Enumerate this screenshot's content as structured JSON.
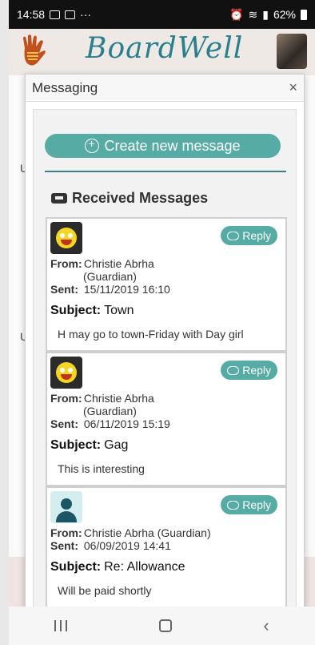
{
  "status_bar": {
    "time": "14:58",
    "battery": "62%",
    "more": "···"
  },
  "app": {
    "brand": "BoardWell"
  },
  "modal": {
    "title": "Messaging",
    "close": "×",
    "create_button": "Create new message",
    "received_heading": "Received Messages",
    "labels": {
      "from": "From:",
      "sent": "Sent:",
      "subject": "Subject:",
      "reply": "Reply"
    },
    "messages": [
      {
        "avatar": "emoji-face",
        "from": "Christie Abrha",
        "from_role": "(Guardian)",
        "sent": "15/11/2019 16:10",
        "subject": "Town",
        "body": "H may go to town-Friday with Day girl"
      },
      {
        "avatar": "emoji-face",
        "from": "Christie Abrha",
        "from_role": "(Guardian)",
        "sent": "06/11/2019 15:19",
        "subject": "Gag",
        "body": "This is interesting"
      },
      {
        "avatar": "person-silhouette",
        "from": "Christie Abrha (Guardian)",
        "from_role": "",
        "sent": "06/09/2019 14:41",
        "subject": "Re: Allowance",
        "body": "Will be paid shortly"
      }
    ]
  },
  "background": {
    "letters": [
      "U",
      "U"
    ]
  },
  "colors": {
    "accent": "#56aca5",
    "brand": "#2a7f8d",
    "divider": "#3d7c86"
  }
}
